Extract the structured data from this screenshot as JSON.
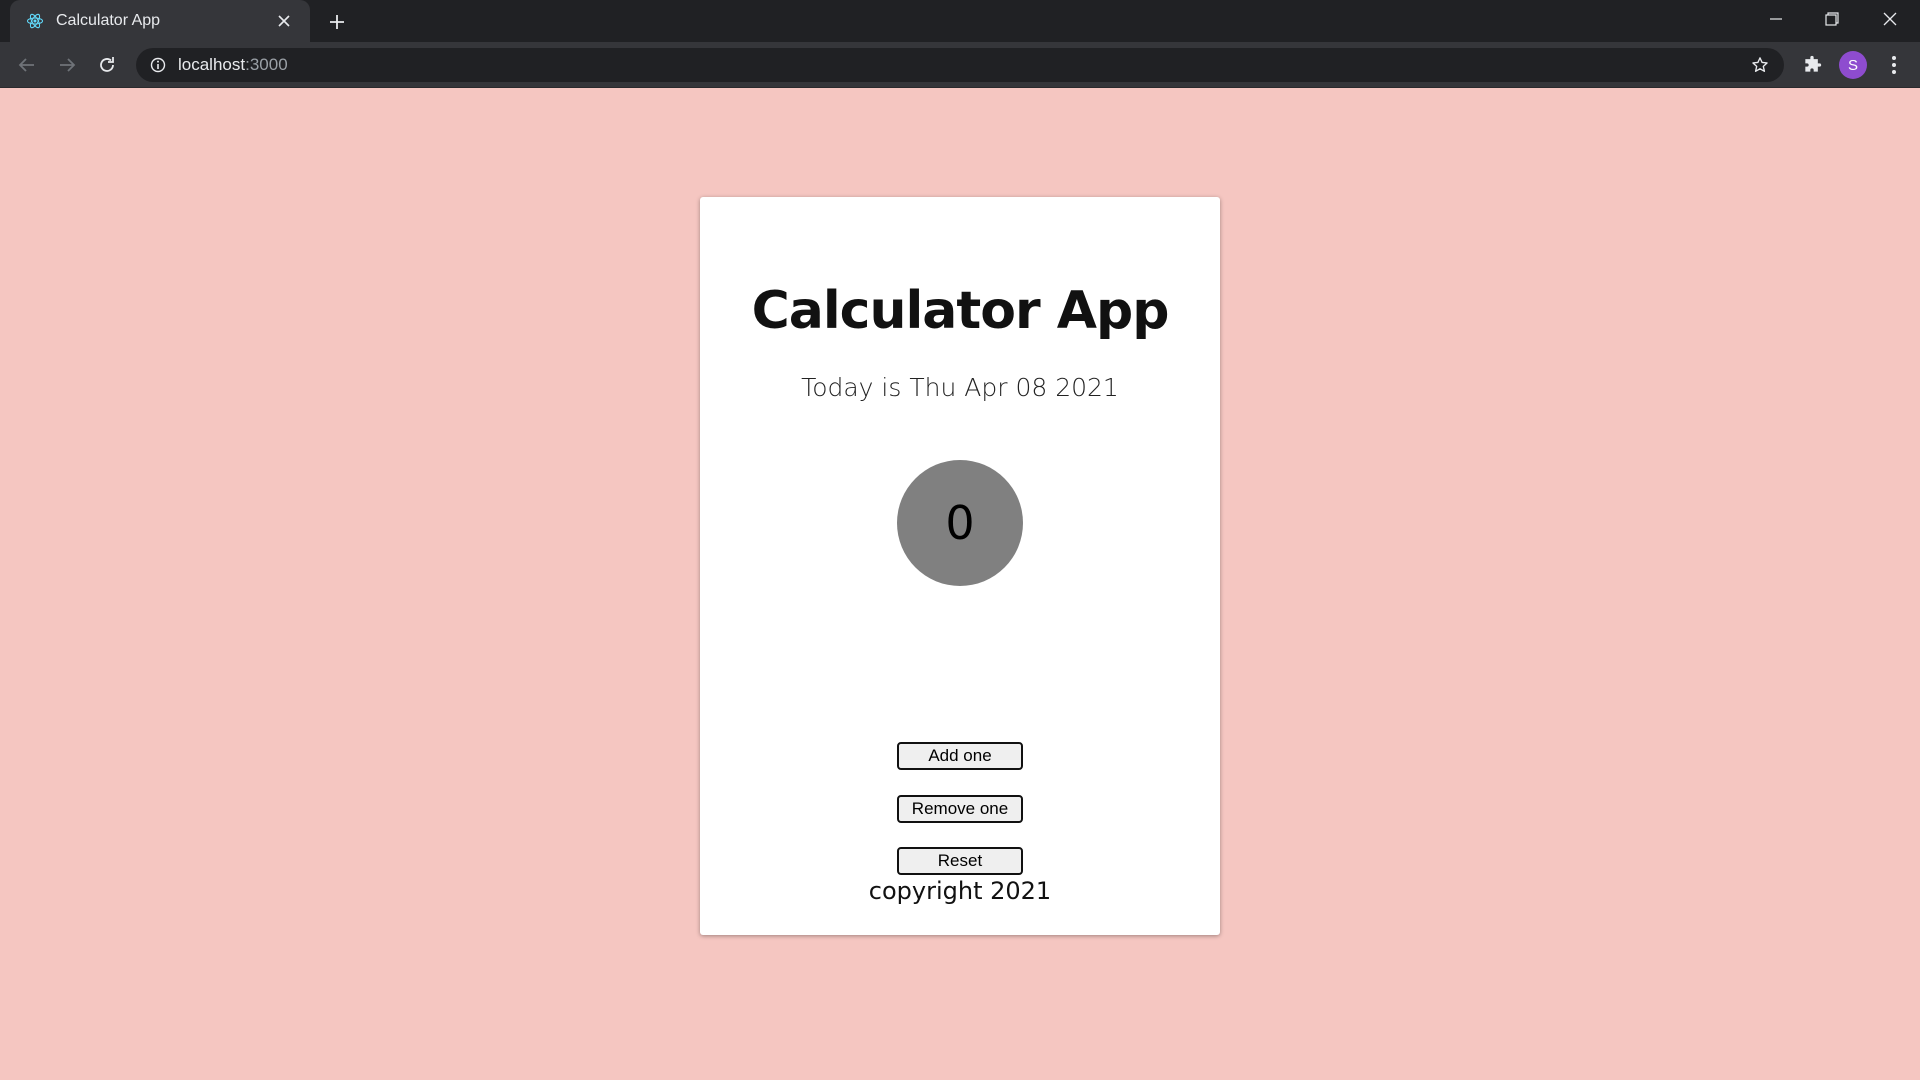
{
  "browser": {
    "tab_title": "Calculator App",
    "url_host": "localhost",
    "url_port": ":3000",
    "profile_initial": "S",
    "colors": {
      "frame": "#202124",
      "toolbar": "#35363a",
      "profile": "#8e4ccf"
    }
  },
  "page": {
    "background": "#f5c6c1",
    "title": "Calculator App",
    "date_text": "Today is Thu Apr 08 2021",
    "counter_value": "0",
    "buttons": {
      "add": "Add one",
      "remove": "Remove one",
      "reset": "Reset"
    },
    "footer": "copyright 2021"
  }
}
